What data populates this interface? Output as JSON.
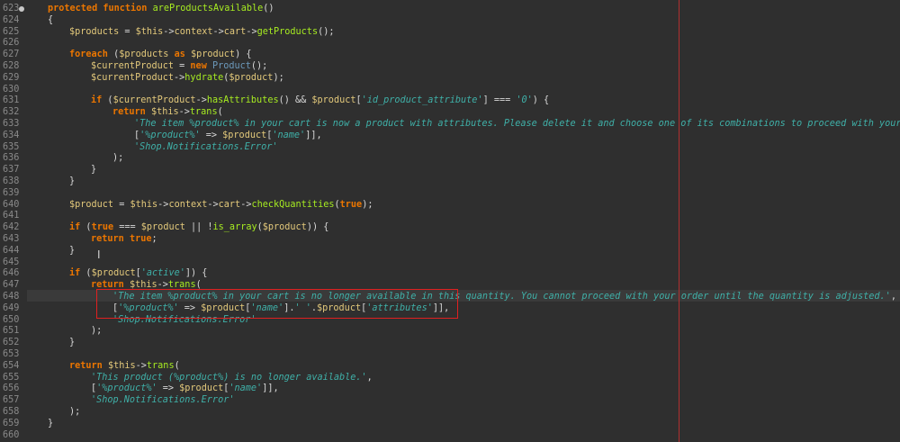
{
  "editor": {
    "current_line": "648",
    "lines": [
      {
        "n": "623",
        "tokens": [
          [
            "kw",
            "protected"
          ],
          [
            "op",
            " "
          ],
          [
            "kw",
            "function"
          ],
          [
            "op",
            " "
          ],
          [
            "fn",
            "areProductsAvailable"
          ],
          [
            "op",
            "()"
          ]
        ]
      },
      {
        "n": "624",
        "tokens": [
          [
            "op",
            "{"
          ]
        ],
        "indent": 0
      },
      {
        "n": "625",
        "tokens": [
          [
            "var",
            "$products"
          ],
          [
            "op",
            " = "
          ],
          [
            "var",
            "$this"
          ],
          [
            "op",
            "->"
          ],
          [
            "var",
            "context"
          ],
          [
            "op",
            "->"
          ],
          [
            "var",
            "cart"
          ],
          [
            "op",
            "->"
          ],
          [
            "fn",
            "getProducts"
          ],
          [
            "op",
            "();"
          ]
        ],
        "indent": 1
      },
      {
        "n": "626",
        "tokens": []
      },
      {
        "n": "627",
        "tokens": [
          [
            "kw",
            "foreach"
          ],
          [
            "op",
            " ("
          ],
          [
            "var",
            "$products"
          ],
          [
            "op",
            " "
          ],
          [
            "kw",
            "as"
          ],
          [
            "op",
            " "
          ],
          [
            "var",
            "$product"
          ],
          [
            "op",
            ") {"
          ]
        ],
        "indent": 1
      },
      {
        "n": "628",
        "tokens": [
          [
            "var",
            "$currentProduct"
          ],
          [
            "op",
            " = "
          ],
          [
            "kw",
            "new"
          ],
          [
            "op",
            " "
          ],
          [
            "cls",
            "Product"
          ],
          [
            "op",
            "();"
          ]
        ],
        "indent": 2
      },
      {
        "n": "629",
        "tokens": [
          [
            "var",
            "$currentProduct"
          ],
          [
            "op",
            "->"
          ],
          [
            "fn",
            "hydrate"
          ],
          [
            "op",
            "("
          ],
          [
            "var",
            "$product"
          ],
          [
            "op",
            ");"
          ]
        ],
        "indent": 2
      },
      {
        "n": "630",
        "tokens": []
      },
      {
        "n": "631",
        "tokens": [
          [
            "kw",
            "if"
          ],
          [
            "op",
            " ("
          ],
          [
            "var",
            "$currentProduct"
          ],
          [
            "op",
            "->"
          ],
          [
            "fn",
            "hasAttributes"
          ],
          [
            "op",
            "() && "
          ],
          [
            "var",
            "$product"
          ],
          [
            "op",
            "["
          ],
          [
            "str",
            "'id_product_attribute'"
          ],
          [
            "op",
            "] === "
          ],
          [
            "str",
            "'0'"
          ],
          [
            "op",
            ") {"
          ]
        ],
        "indent": 2
      },
      {
        "n": "632",
        "tokens": [
          [
            "kw",
            "return"
          ],
          [
            "op",
            " "
          ],
          [
            "var",
            "$this"
          ],
          [
            "op",
            "->"
          ],
          [
            "fn",
            "trans"
          ],
          [
            "op",
            "("
          ]
        ],
        "indent": 3
      },
      {
        "n": "633",
        "tokens": [
          [
            "str",
            "'The item %product% in your cart is now a product with attributes. Please delete it and choose one of its combinations to proceed with your or"
          ]
        ],
        "indent": 4
      },
      {
        "n": "634",
        "tokens": [
          [
            "op",
            "["
          ],
          [
            "str",
            "'%product%'"
          ],
          [
            "op",
            " => "
          ],
          [
            "var",
            "$product"
          ],
          [
            "op",
            "["
          ],
          [
            "str",
            "'name'"
          ],
          [
            "op",
            "]],"
          ]
        ],
        "indent": 4
      },
      {
        "n": "635",
        "tokens": [
          [
            "str",
            "'Shop.Notifications.Error'"
          ]
        ],
        "indent": 4
      },
      {
        "n": "636",
        "tokens": [
          [
            "op",
            ");"
          ]
        ],
        "indent": 3
      },
      {
        "n": "637",
        "tokens": [
          [
            "op",
            "}"
          ]
        ],
        "indent": 2
      },
      {
        "n": "638",
        "tokens": [
          [
            "op",
            "}"
          ]
        ],
        "indent": 1
      },
      {
        "n": "639",
        "tokens": []
      },
      {
        "n": "640",
        "tokens": [
          [
            "var",
            "$product"
          ],
          [
            "op",
            " = "
          ],
          [
            "var",
            "$this"
          ],
          [
            "op",
            "->"
          ],
          [
            "var",
            "context"
          ],
          [
            "op",
            "->"
          ],
          [
            "var",
            "cart"
          ],
          [
            "op",
            "->"
          ],
          [
            "fn",
            "checkQuantities"
          ],
          [
            "op",
            "("
          ],
          [
            "kw",
            "true"
          ],
          [
            "op",
            ");"
          ]
        ],
        "indent": 1
      },
      {
        "n": "641",
        "tokens": []
      },
      {
        "n": "642",
        "tokens": [
          [
            "kw",
            "if"
          ],
          [
            "op",
            " ("
          ],
          [
            "kw",
            "true"
          ],
          [
            "op",
            " === "
          ],
          [
            "var",
            "$product"
          ],
          [
            "op",
            " || !"
          ],
          [
            "fn",
            "is_array"
          ],
          [
            "op",
            "("
          ],
          [
            "var",
            "$product"
          ],
          [
            "op",
            ")) {"
          ]
        ],
        "indent": 1
      },
      {
        "n": "643",
        "tokens": [
          [
            "kw",
            "return"
          ],
          [
            "op",
            " "
          ],
          [
            "kw",
            "true"
          ],
          [
            "op",
            ";"
          ]
        ],
        "indent": 2
      },
      {
        "n": "644",
        "tokens": [
          [
            "op",
            "}"
          ]
        ],
        "indent": 1
      },
      {
        "n": "645",
        "tokens": []
      },
      {
        "n": "646",
        "tokens": [
          [
            "kw",
            "if"
          ],
          [
            "op",
            " ("
          ],
          [
            "var",
            "$product"
          ],
          [
            "op",
            "["
          ],
          [
            "str",
            "'active'"
          ],
          [
            "op",
            "]) {"
          ]
        ],
        "indent": 1
      },
      {
        "n": "647",
        "tokens": [
          [
            "kw",
            "return"
          ],
          [
            "op",
            " "
          ],
          [
            "var",
            "$this"
          ],
          [
            "op",
            "->"
          ],
          [
            "fn",
            "trans"
          ],
          [
            "op",
            "("
          ]
        ],
        "indent": 2
      },
      {
        "n": "648",
        "tokens": [
          [
            "str",
            "'The item %product% in your cart is no longer available in this quantity. You cannot proceed with your order until the quantity is adjusted.'"
          ],
          [
            "op",
            ","
          ]
        ],
        "indent": 3
      },
      {
        "n": "649",
        "tokens": [
          [
            "op",
            "["
          ],
          [
            "str",
            "'%product%'"
          ],
          [
            "op",
            " => "
          ],
          [
            "var",
            "$product"
          ],
          [
            "op",
            "["
          ],
          [
            "str",
            "'name'"
          ],
          [
            "op",
            "]."
          ],
          [
            "str",
            "' '"
          ],
          [
            "op",
            "."
          ],
          [
            "var",
            "$product"
          ],
          [
            "op",
            "["
          ],
          [
            "str",
            "'attributes'"
          ],
          [
            "op",
            "]],"
          ]
        ],
        "indent": 3
      },
      {
        "n": "650",
        "tokens": [
          [
            "str",
            "'Shop.Notifications.Error'"
          ]
        ],
        "indent": 3
      },
      {
        "n": "651",
        "tokens": [
          [
            "op",
            ");"
          ]
        ],
        "indent": 2
      },
      {
        "n": "652",
        "tokens": [
          [
            "op",
            "}"
          ]
        ],
        "indent": 1
      },
      {
        "n": "653",
        "tokens": []
      },
      {
        "n": "654",
        "tokens": [
          [
            "kw",
            "return"
          ],
          [
            "op",
            " "
          ],
          [
            "var",
            "$this"
          ],
          [
            "op",
            "->"
          ],
          [
            "fn",
            "trans"
          ],
          [
            "op",
            "("
          ]
        ],
        "indent": 1
      },
      {
        "n": "655",
        "tokens": [
          [
            "str",
            "'This product (%product%) is no longer available.'"
          ],
          [
            "op",
            ","
          ]
        ],
        "indent": 2
      },
      {
        "n": "656",
        "tokens": [
          [
            "op",
            "["
          ],
          [
            "str",
            "'%product%'"
          ],
          [
            "op",
            " => "
          ],
          [
            "var",
            "$product"
          ],
          [
            "op",
            "["
          ],
          [
            "str",
            "'name'"
          ],
          [
            "op",
            "]],"
          ]
        ],
        "indent": 2
      },
      {
        "n": "657",
        "tokens": [
          [
            "str",
            "'Shop.Notifications.Error'"
          ]
        ],
        "indent": 2
      },
      {
        "n": "658",
        "tokens": [
          [
            "op",
            ");"
          ]
        ],
        "indent": 1
      },
      {
        "n": "659",
        "tokens": [
          [
            "op",
            "}"
          ]
        ],
        "indent": 0
      },
      {
        "n": "660",
        "tokens": []
      }
    ]
  },
  "colors": {
    "background": "#2f2f2f",
    "margin_line": "#b03030",
    "highlight_box": "#e02020"
  }
}
